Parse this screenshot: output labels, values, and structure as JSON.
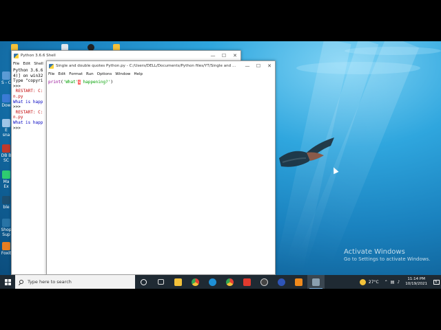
{
  "desktop": {
    "icons": [
      {
        "label": "S - C"
      },
      {
        "label": "Dow"
      },
      {
        "label": "E sna"
      },
      {
        "label": "DB B SC"
      },
      {
        "label": "Ma Ex"
      },
      {
        "label": "ble"
      },
      {
        "label": "Shop Sup"
      },
      {
        "label": "Foxit"
      }
    ],
    "activation": {
      "title": "Activate Windows",
      "subtitle": "Go to Settings to activate Windows."
    }
  },
  "shell": {
    "title": "Python 3.6.6 Shell",
    "menu": [
      "File",
      "Edit",
      "Shell"
    ],
    "lines": [
      {
        "text": "Python 3.6.6",
        "color": "black"
      },
      {
        "text": "4)] on win32",
        "color": "black"
      },
      {
        "text": "Type \"copyri",
        "color": "black"
      },
      {
        "text": ">>> ",
        "color": "black"
      },
      {
        "text": " RESTART: C:",
        "color": "black"
      },
      {
        "text": "n.py",
        "color": "black"
      },
      {
        "text": "What is happ",
        "color": "blue"
      },
      {
        "text": ">>> ",
        "color": "black"
      },
      {
        "text": " RESTART: C:",
        "color": "black"
      },
      {
        "text": "n.py",
        "color": "black"
      },
      {
        "text": "What is happ",
        "color": "blue"
      },
      {
        "text": ">>> ",
        "color": "black"
      }
    ]
  },
  "editor": {
    "title": "Single and double quotes Python.py - C:/Users/DELL/Documents/Python files/YT/Single and ...",
    "menu": [
      "File",
      "Edit",
      "Format",
      "Run",
      "Options",
      "Window",
      "Help"
    ],
    "code": {
      "func": "print",
      "open": "(",
      "str_a": "'What'",
      "error_char": "s",
      "str_b": " happening?'",
      "close": ")"
    }
  },
  "taskbar": {
    "search_placeholder": "Type here to search",
    "apps": [
      {
        "name": "task-view",
        "color": "#ffffff"
      },
      {
        "name": "taskview-grid",
        "color": "#dddddd"
      },
      {
        "name": "file-explorer",
        "color": "#f3c13a"
      },
      {
        "name": "chrome",
        "color": "#e44134"
      },
      {
        "name": "edge",
        "color": "#1e90d6"
      },
      {
        "name": "chrome-alt",
        "color": "#34a853"
      },
      {
        "name": "jf-app",
        "color": "#e03a2e"
      },
      {
        "name": "obs",
        "color": "#444444"
      },
      {
        "name": "vpn",
        "color": "#2e55b8"
      },
      {
        "name": "orange-app",
        "color": "#f08a1c"
      },
      {
        "name": "idle",
        "color": "#8aa0b0"
      }
    ],
    "weather": "27°C",
    "time": "11:14 PM",
    "date": "10/19/2021",
    "notify_count": "6"
  }
}
